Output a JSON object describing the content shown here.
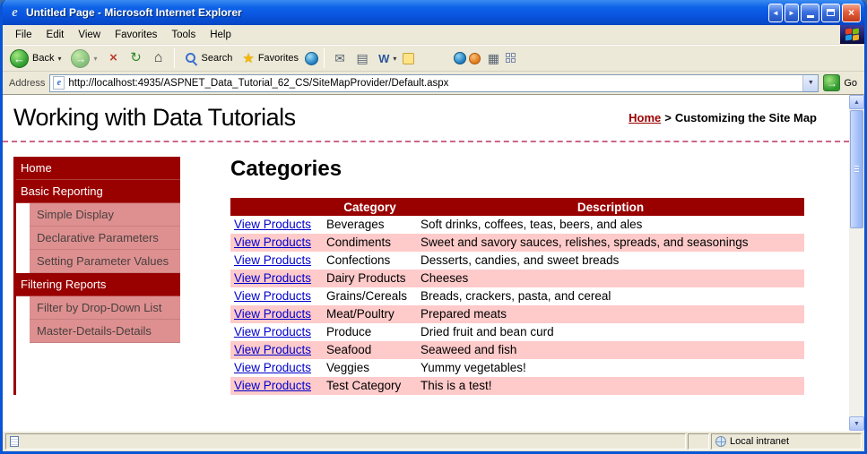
{
  "window": {
    "title": "Untitled Page - Microsoft Internet Explorer"
  },
  "menubar": {
    "items": [
      "File",
      "Edit",
      "View",
      "Favorites",
      "Tools",
      "Help"
    ]
  },
  "toolbar": {
    "back_label": "Back",
    "search_label": "Search",
    "favorites_label": "Favorites"
  },
  "addressbar": {
    "label": "Address",
    "url": "http://localhost:4935/ASPNET_Data_Tutorial_62_CS/SiteMapProvider/Default.aspx",
    "go_label": "Go"
  },
  "header": {
    "title": "Working with Data Tutorials",
    "breadcrumb_home": "Home",
    "breadcrumb_separator": ">",
    "breadcrumb_current": "Customizing the Site Map"
  },
  "sidebar": {
    "items": [
      {
        "label": "Home",
        "level": "top"
      },
      {
        "label": "Basic Reporting",
        "level": "top"
      },
      {
        "label": "Simple Display",
        "level": "sub"
      },
      {
        "label": "Declarative Parameters",
        "level": "sub"
      },
      {
        "label": "Setting Parameter Values",
        "level": "sub"
      },
      {
        "label": "Filtering Reports",
        "level": "top"
      },
      {
        "label": "Filter by Drop-Down List",
        "level": "sub"
      },
      {
        "label": "Master-Details-Details",
        "level": "sub"
      }
    ]
  },
  "content": {
    "heading": "Categories",
    "table": {
      "headers": [
        "",
        "Category",
        "Description"
      ],
      "link_label": "View Products",
      "rows": [
        {
          "category": "Beverages",
          "description": "Soft drinks, coffees, teas, beers, and ales"
        },
        {
          "category": "Condiments",
          "description": "Sweet and savory sauces, relishes, spreads, and seasonings"
        },
        {
          "category": "Confections",
          "description": "Desserts, candies, and sweet breads"
        },
        {
          "category": "Dairy Products",
          "description": "Cheeses"
        },
        {
          "category": "Grains/Cereals",
          "description": "Breads, crackers, pasta, and cereal"
        },
        {
          "category": "Meat/Poultry",
          "description": "Prepared meats"
        },
        {
          "category": "Produce",
          "description": "Dried fruit and bean curd"
        },
        {
          "category": "Seafood",
          "description": "Seaweed and fish"
        },
        {
          "category": "Veggies",
          "description": "Yummy vegetables!"
        },
        {
          "category": "Test Category",
          "description": "This is a test!"
        }
      ]
    }
  },
  "statusbar": {
    "zone": "Local intranet"
  },
  "icons": {
    "ie": "e",
    "back_arrow": "←",
    "forward_arrow": "→",
    "stop": "×",
    "refresh": "↻",
    "home": "⌂",
    "dropdown_caret": "▾",
    "star": "★",
    "mail": "✉",
    "printer": "▤",
    "word": "W",
    "building": "▦",
    "go_arrow": "→",
    "close": "×",
    "left_arrow": "◄",
    "right_arrow": "►",
    "up_arrow": "▲",
    "down_arrow": "▼"
  },
  "colors": {
    "accent_dark_red": "#990000",
    "row_alt_pink": "#FFCACA",
    "sidebar_sub_pink": "#DE9090",
    "link_blue": "#0000CC",
    "xp_title_blue": "#0A55E0",
    "dashed_divider": "#CC6688"
  }
}
